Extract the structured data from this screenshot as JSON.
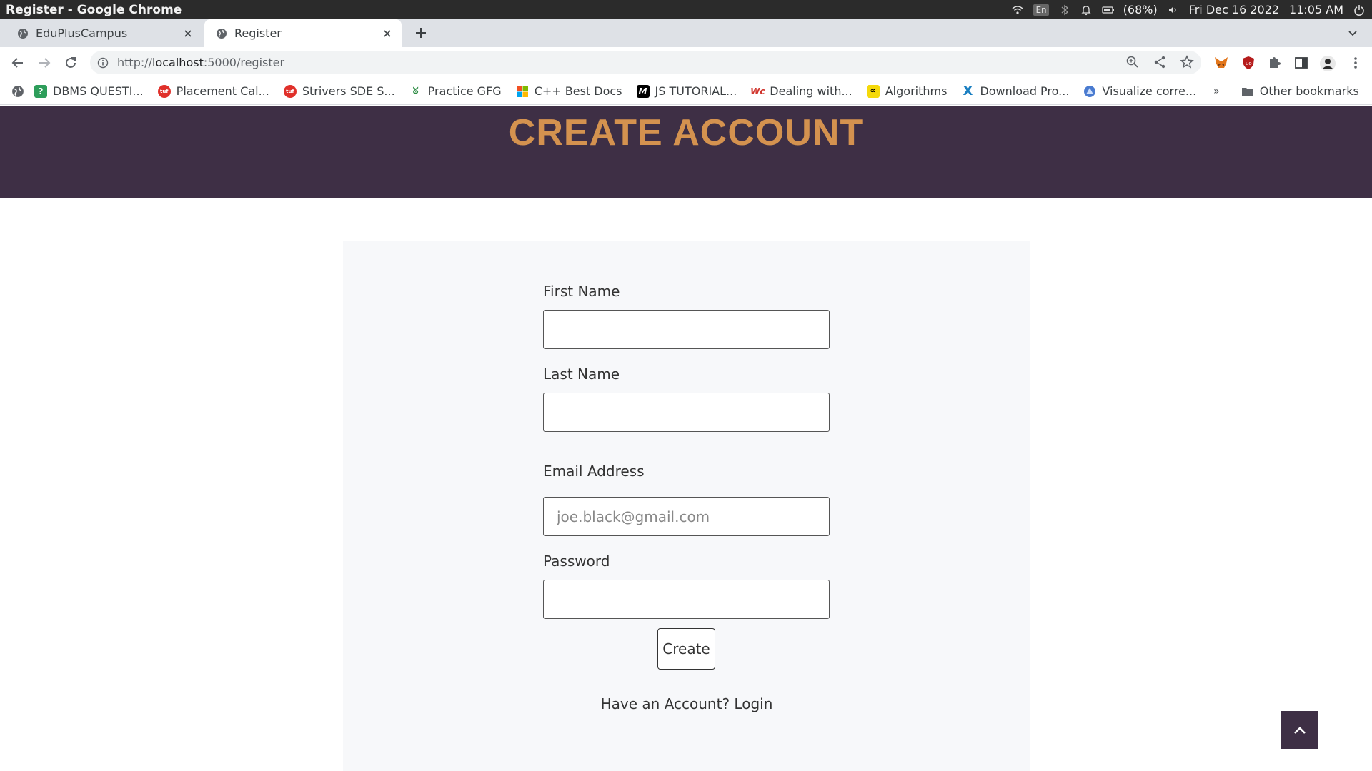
{
  "os": {
    "window_title": "Register - Google Chrome",
    "lang": "En",
    "battery": "(68%)",
    "date": "Fri Dec 16 2022",
    "time": "11:05 AM"
  },
  "tabs": [
    {
      "label": "EduPlusCampus"
    },
    {
      "label": "Register"
    }
  ],
  "address": {
    "scheme": "http://",
    "host": "localhost",
    "path": ":5000/register"
  },
  "bookmarks": {
    "items": [
      {
        "label": "DBMS QUESTI...",
        "icon": "question-icon",
        "color": "#2e9e5b"
      },
      {
        "label": "Placement Cal...",
        "icon": "tuf-icon",
        "color": "#e0302a"
      },
      {
        "label": "Strivers SDE S...",
        "icon": "tuf-icon",
        "color": "#e0302a"
      },
      {
        "label": "Practice GFG",
        "icon": "gfg-icon",
        "color": "#2f8d46"
      },
      {
        "label": "C++ Best Docs",
        "icon": "microsoft-icon",
        "color": "#f25022"
      },
      {
        "label": "JS TUTORIAL...",
        "icon": "m-icon",
        "color": "#000000"
      },
      {
        "label": "Dealing with...",
        "icon": "wc-icon",
        "color": "#d0342c"
      },
      {
        "label": "Algorithms",
        "icon": "algo-icon",
        "color": "#f5d90a"
      },
      {
        "label": "Download Pro...",
        "icon": "x-icon",
        "color": "#1a7fc1"
      },
      {
        "label": "Visualize corre...",
        "icon": "visualize-icon",
        "color": "#4a7bd0"
      }
    ],
    "more": "»",
    "other": "Other bookmarks"
  },
  "page": {
    "title": "CREATE ACCOUNT",
    "first_name_label": "First Name",
    "last_name_label": "Last Name",
    "email_label": "Email Address",
    "email_placeholder": "joe.black@gmail.com",
    "password_label": "Password",
    "create_button": "Create",
    "login_text": "Have an Account? Login"
  },
  "colors": {
    "header_band": "#3e2f45",
    "title": "#d4924f",
    "card_bg": "#f7f8fa"
  }
}
